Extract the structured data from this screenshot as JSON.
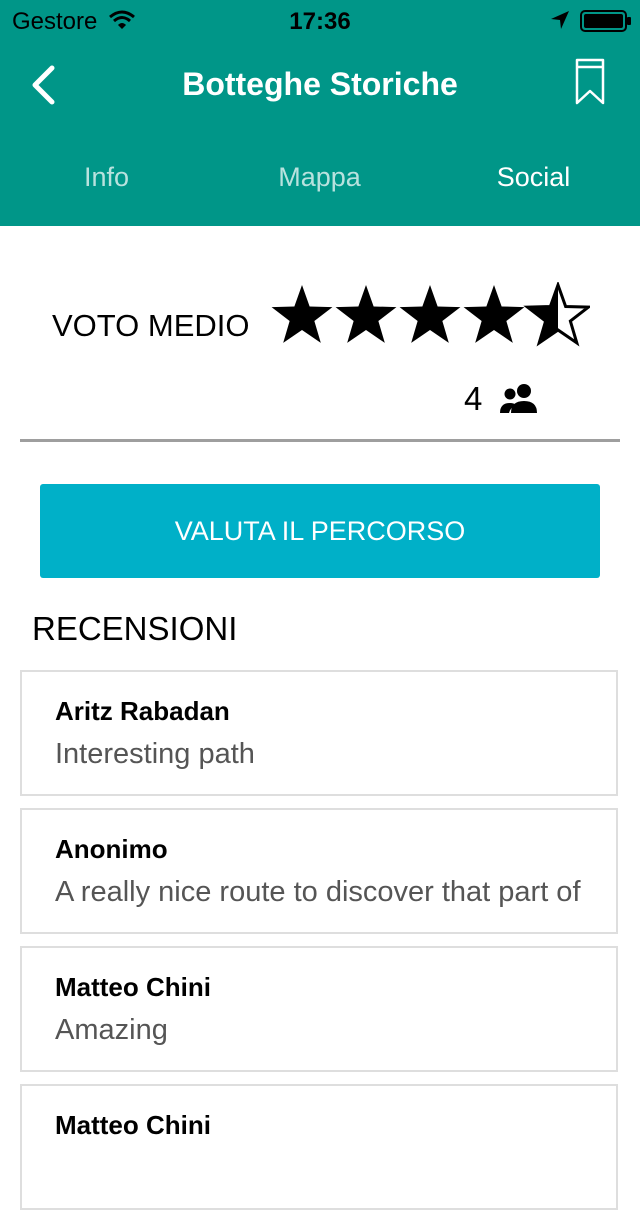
{
  "status_bar": {
    "carrier": "Gestore",
    "time": "17:36",
    "icons": [
      "wifi-icon",
      "location-arrow-icon",
      "battery-icon"
    ]
  },
  "navbar": {
    "title": "Botteghe Storiche",
    "left_icon": "back-chevron-icon",
    "right_icon": "bookmark-icon"
  },
  "tabs": [
    {
      "label": "Info",
      "active": false
    },
    {
      "label": "Mappa",
      "active": false
    },
    {
      "label": "Social",
      "active": true
    }
  ],
  "rating": {
    "label": "VOTO MEDIO",
    "stars": 4.5,
    "max_stars": 5,
    "count": "4",
    "count_icon": "people-icon"
  },
  "rate_button": "VALUTA IL PERCORSO",
  "reviews_title": "RECENSIONI",
  "reviews": [
    {
      "author": "Aritz Rabadan",
      "text": "Interesting path"
    },
    {
      "author": "Anonimo",
      "text": "A really nice route to discover that part of"
    },
    {
      "author": "Matteo Chini",
      "text": "Amazing"
    },
    {
      "author": "Matteo Chini",
      "text": ""
    }
  ],
  "colors": {
    "header": "#009688",
    "button": "#00b0c8",
    "divider": "#9e9e9e"
  }
}
